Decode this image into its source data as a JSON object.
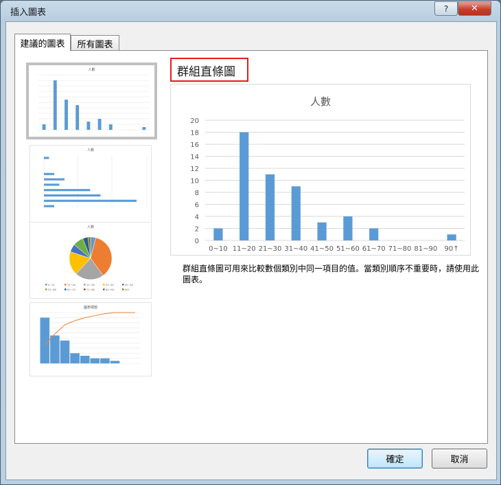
{
  "window": {
    "title": "插入圖表",
    "help_label": "?",
    "close_label": "✕"
  },
  "tabs": [
    {
      "label": "建議的圖表",
      "active": true
    },
    {
      "label": "所有圖表",
      "active": false
    }
  ],
  "recommended": {
    "heading": "群組直條圖",
    "description": "群組直條圖可用來比較數個類別中同一項目的值。當類別順序不重要時，請使用此圖表。"
  },
  "thumbnails": {
    "column_title": "人數",
    "bar_title": "人數",
    "pie_title": "人數",
    "pareto_title": "圖表標題",
    "pie_legend": [
      "0~10",
      "11~20",
      "21~30",
      "31~40",
      "41~50",
      "51~60",
      "61~70",
      "71~80",
      "81~90",
      "90↑"
    ],
    "colors": [
      "#5b9bd5",
      "#ed7d31",
      "#a5a5a5",
      "#ffc000",
      "#4472c4",
      "#70ad47",
      "#255e91",
      "#9e480e",
      "#636363",
      "#997300"
    ]
  },
  "chart_data": {
    "type": "bar",
    "title": "人數",
    "categories": [
      "0~10",
      "11~20",
      "21~30",
      "31~40",
      "41~50",
      "51~60",
      "61~70",
      "71~80",
      "81~90",
      "90↑"
    ],
    "values": [
      2,
      18,
      11,
      9,
      3,
      4,
      2,
      0,
      0,
      1
    ],
    "ylim": [
      0,
      20
    ],
    "yticks": [
      0,
      2,
      4,
      6,
      8,
      10,
      12,
      14,
      16,
      18,
      20
    ],
    "xlabel": "",
    "ylabel": "",
    "bar_color": "#5b9bd5",
    "grid": true
  },
  "buttons": {
    "ok": "確定",
    "cancel": "取消"
  }
}
